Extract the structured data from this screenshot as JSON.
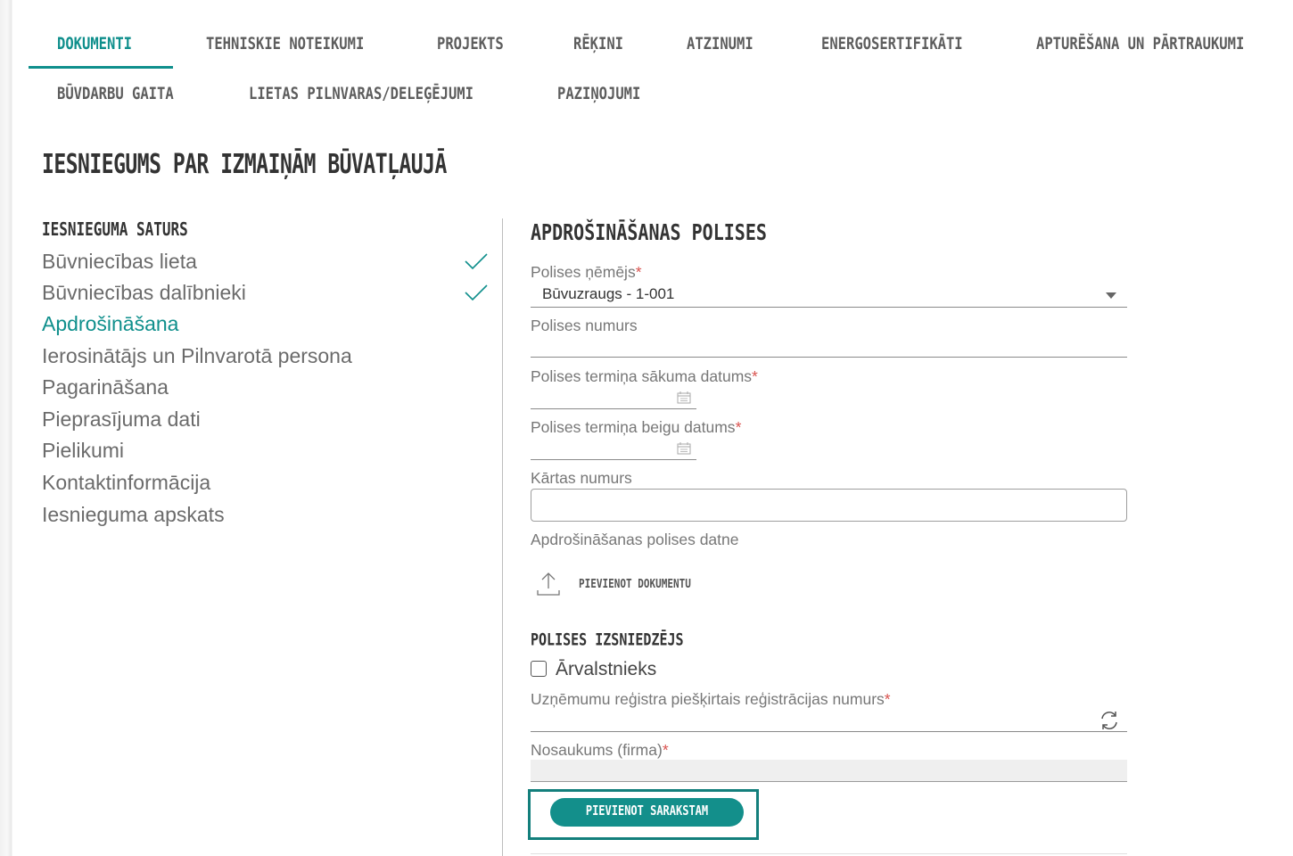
{
  "tabs_row1": [
    {
      "label": "DOKUMENTI",
      "active": true
    },
    {
      "label": "TEHNISKIE NOTEIKUMI"
    },
    {
      "label": "PROJEKTS"
    },
    {
      "label": "RĒĶINI"
    },
    {
      "label": "ATZINUMI"
    },
    {
      "label": "ENERGOSERTIFIKĀTI"
    },
    {
      "label": "APTURĒŠANA UN PĀRTRAUKUMI"
    }
  ],
  "tabs_row2": [
    {
      "label": "BŪVDARBU GAITA"
    },
    {
      "label": "LIETAS PILNVARAS/DELEĢĒJUMI"
    },
    {
      "label": "PAZIŅOJUMI"
    }
  ],
  "page_title": "IESNIEGUMS PAR IZMAIŅĀM BŪVATĻAUJĀ",
  "sidebar": {
    "heading": "IESNIEGUMA SATURS",
    "items": [
      {
        "label": "Būvniecības lieta",
        "done": true
      },
      {
        "label": "Būvniecības dalībnieki",
        "done": true
      },
      {
        "label": "Apdrošināšana",
        "active": true
      },
      {
        "label": "Ierosinātājs un Pilnvarotā persona"
      },
      {
        "label": "Pagarināšana"
      },
      {
        "label": "Pieprasījuma dati"
      },
      {
        "label": "Pielikumi"
      },
      {
        "label": "Kontaktinformācija"
      },
      {
        "label": "Iesnieguma apskats"
      }
    ]
  },
  "form": {
    "heading": "APDROŠINĀŠANAS POLISES",
    "policy_holder_label": "Polises ņēmējs",
    "policy_holder_value": "Būvuzraugs - 1-001",
    "policy_number_label": "Polises numurs",
    "start_date_label": "Polises termiņa sākuma datums",
    "end_date_label": "Polises termiņa beigu datums",
    "order_number_label": "Kārtas numurs",
    "file_label": "Apdrošināšanas polises datne",
    "add_document_label": "PIEVIENOT DOKUMENTU",
    "issuer_heading": "POLISES IZSNIEDZĒJS",
    "foreigner_label": "Ārvalstnieks",
    "foreigner_checked": false,
    "reg_number_label": "Uzņēmumu reģistra piešķirtais reģistrācijas numurs",
    "name_label": "Nosaukums (firma)",
    "required_mark": "*",
    "add_to_list_label": "PIEVIENOT SARAKSTAM"
  },
  "colors": {
    "accent": "#0f8f8c",
    "required": "#d9534f",
    "text": "#555555"
  }
}
